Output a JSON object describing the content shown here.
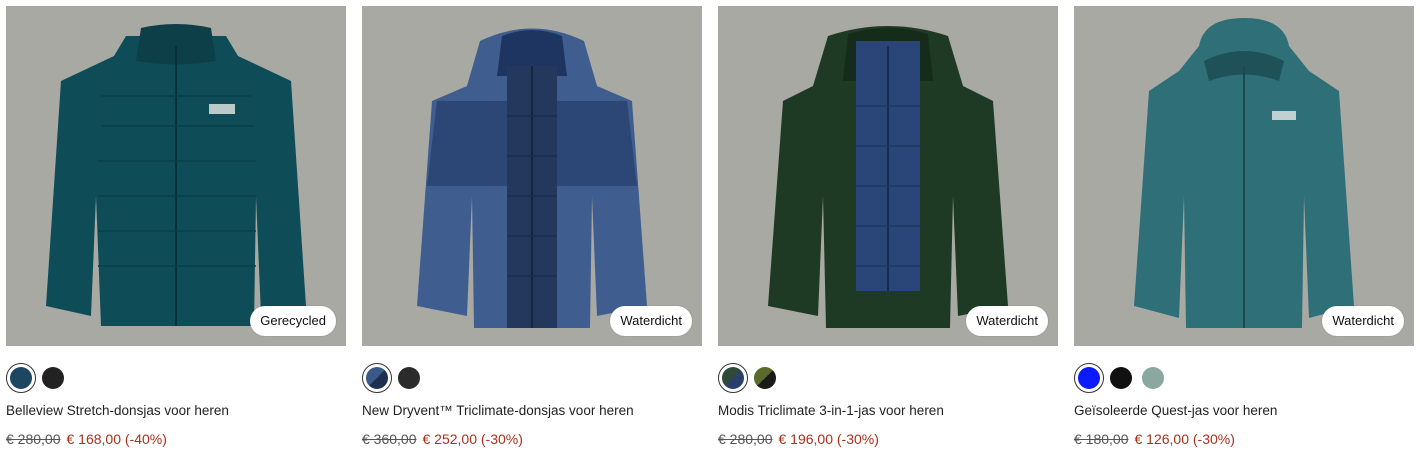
{
  "colors": {
    "sale_price": "#a8321b",
    "image_bg": "#a9a9a3",
    "badge_bg": "#ffffff"
  },
  "products": [
    {
      "name": "Belleview Stretch-donsjas voor heren",
      "badge": "Gerecycled",
      "original_price": "€ 280,00",
      "sale_price": "€ 168,00 (-40%)",
      "swatches": [
        "#1d4760",
        "#222222"
      ],
      "jacket_icon": "jacket-image"
    },
    {
      "name": "New Dryvent™ Triclimate-donsjas voor heren",
      "badge": "Waterdicht",
      "original_price": "€ 360,00",
      "sale_price": "€ 252,00 (-30%)",
      "swatches": [
        "#2a3f6a",
        "#2b2b2b"
      ],
      "jacket_icon": "jacket-image"
    },
    {
      "name": "Modis Triclimate 3-in-1-jas voor heren",
      "badge": "Waterdicht",
      "original_price": "€ 280,00",
      "sale_price": "€ 196,00 (-30%)",
      "swatches": [
        "#2f4a3a",
        "#4a5a2a"
      ],
      "jacket_icon": "jacket-image"
    },
    {
      "name": "Geïsoleerde Quest-jas voor heren",
      "badge": "Waterdicht",
      "original_price": "€ 180,00",
      "sale_price": "€ 126,00 (-30%)",
      "swatches": [
        "#0b1aff",
        "#111111",
        "#8aa8a0"
      ],
      "jacket_icon": "jacket-image"
    }
  ]
}
